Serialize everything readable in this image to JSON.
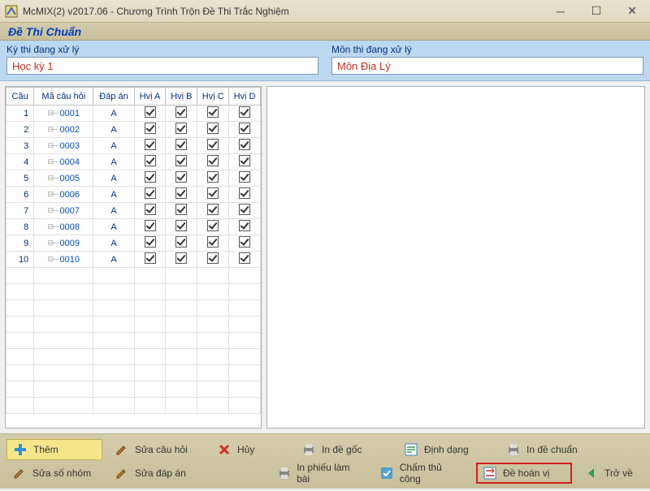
{
  "window": {
    "title": "McMIX(2) v2017.06 - Chương Trình Trộn Đề Thi Trắc Nghiệm"
  },
  "header": {
    "title": "Đề Thi Chuẩn"
  },
  "info": {
    "exam_label": "Kỳ thi đang xử lý",
    "exam_value": "Học kỳ 1",
    "subject_label": "Môn thi đang xử lý",
    "subject_value": "Môn Địa Lý"
  },
  "table": {
    "headers": {
      "cau": "Câu",
      "code": "Mã câu hỏi",
      "dapan": "Đáp án",
      "a": "Hvị A",
      "b": "Hvị B",
      "c": "Hvị C",
      "d": "Hvị D"
    },
    "rows": [
      {
        "n": "1",
        "code": "0001",
        "ans": "A",
        "a": true,
        "b": true,
        "c": true,
        "d": true
      },
      {
        "n": "2",
        "code": "0002",
        "ans": "A",
        "a": true,
        "b": true,
        "c": true,
        "d": true
      },
      {
        "n": "3",
        "code": "0003",
        "ans": "A",
        "a": true,
        "b": true,
        "c": true,
        "d": true
      },
      {
        "n": "4",
        "code": "0004",
        "ans": "A",
        "a": true,
        "b": true,
        "c": true,
        "d": true
      },
      {
        "n": "5",
        "code": "0005",
        "ans": "A",
        "a": true,
        "b": true,
        "c": true,
        "d": true
      },
      {
        "n": "6",
        "code": "0006",
        "ans": "A",
        "a": true,
        "b": true,
        "c": true,
        "d": true
      },
      {
        "n": "7",
        "code": "0007",
        "ans": "A",
        "a": true,
        "b": true,
        "c": true,
        "d": true
      },
      {
        "n": "8",
        "code": "0008",
        "ans": "A",
        "a": true,
        "b": true,
        "c": true,
        "d": true
      },
      {
        "n": "9",
        "code": "0009",
        "ans": "A",
        "a": true,
        "b": true,
        "c": true,
        "d": true
      },
      {
        "n": "10",
        "code": "0010",
        "ans": "A",
        "a": true,
        "b": true,
        "c": true,
        "d": true
      }
    ],
    "empty_rows": 9
  },
  "toolbar": {
    "them": "Thêm",
    "sua_cau": "Sửa câu hỏi",
    "huy": "Hủy",
    "in_goc": "In đề gốc",
    "dinh_dang": "Định dạng",
    "in_chuan": "In đề chuẩn",
    "sua_so_nhom": "Sửa số nhóm",
    "sua_dapan": "Sửa đáp án",
    "in_phieu": "In phiếu làm bài",
    "cham": "Chấm thủ công",
    "de_hoanvi": "Đề hoán vị",
    "tro_ve": "Trở về"
  }
}
